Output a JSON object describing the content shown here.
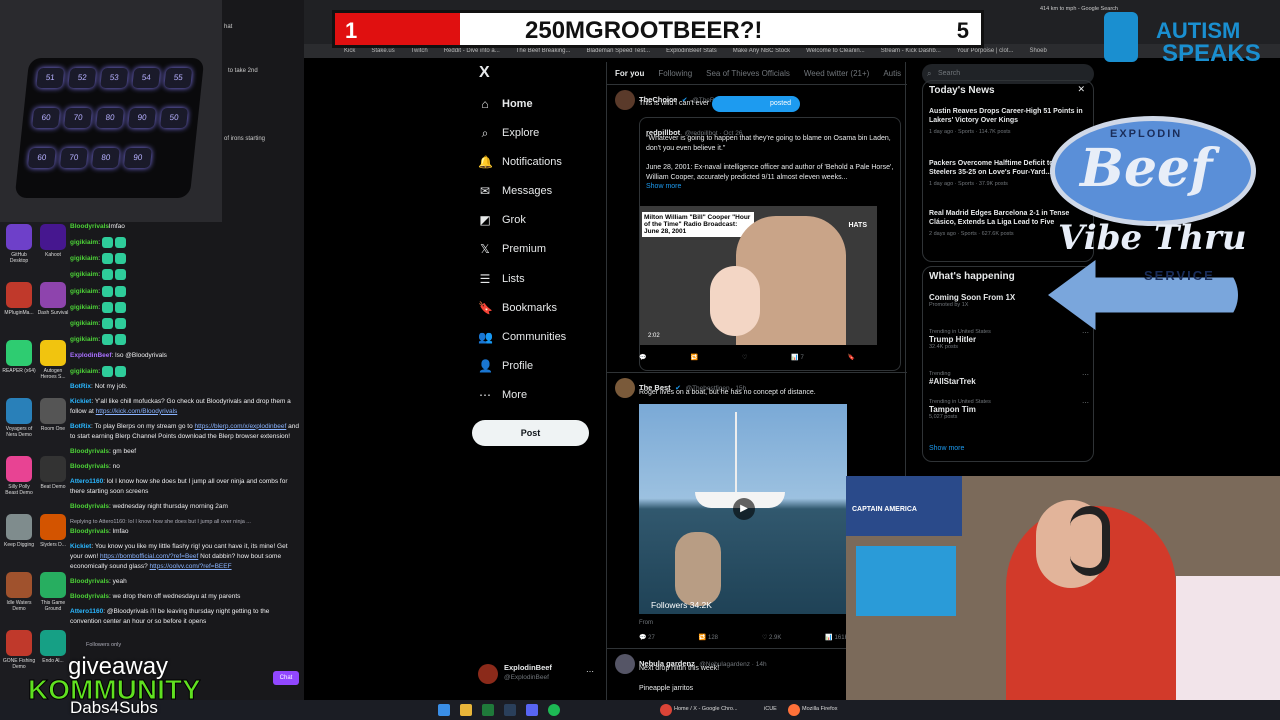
{
  "banner": {
    "left_score": "1",
    "title": "250MGROOTBEER?!",
    "right_score": "5"
  },
  "browser": {
    "bookmarks": [
      "Kick",
      "Stake.us",
      "Twitch",
      "Reddit - Dive into a...",
      "The Beef Breaking...",
      "Blademan Speed Test...",
      "ExplodinBeef Stats",
      "Make Any NBC Stock",
      "Welcome to Cleanin...",
      "Stream - Kick Dashb...",
      "Your Porpoise | clot...",
      "Shoeb"
    ],
    "tab_speed": "414 km to mph - Google Search"
  },
  "chat_panel": {
    "top_snippets": [
      "hat",
      "to take 2nd",
      "of irons starting"
    ],
    "messages": [
      {
        "user": "Bloodyrivals",
        "text": "lmfao",
        "type": "green"
      },
      {
        "user": "gigikiaim",
        "text": "",
        "emotes": 2,
        "type": "green"
      },
      {
        "user": "gigikiaim",
        "text": "",
        "emotes": 2,
        "type": "green"
      },
      {
        "user": "gigikiaim",
        "text": "",
        "emotes": 2,
        "type": "green"
      },
      {
        "user": "gigikiaim",
        "text": "",
        "emotes": 2,
        "type": "green"
      },
      {
        "user": "gigikiaim",
        "text": "",
        "emotes": 2,
        "type": "green"
      },
      {
        "user": "gigikiaim",
        "text": "",
        "emotes": 2,
        "type": "green"
      },
      {
        "user": "gigikiaim",
        "text": "",
        "emotes": 2,
        "type": "green"
      },
      {
        "user": "ExplodinBeef",
        "text": ": lso @Bloodyrivals",
        "type": "pur"
      },
      {
        "user": "gigikiaim",
        "text": "",
        "emotes": 2,
        "type": "green"
      },
      {
        "user": "BotRix",
        "text": ": Not my job.",
        "type": "bot"
      },
      {
        "user": "Kickiet",
        "text": ": Y'all like chill mofuckas? Go check out Bloodyrivals and drop them a follow at ",
        "link": "https://kick.com/Bloodyrivals",
        "type": "bot"
      },
      {
        "user": "BotRix",
        "text": ": To play Blerps on my stream go to ",
        "link": "https://blerp.com/x/explodinbeef",
        "text2": " and to start earning Blerp Channel Points download the Blerp browser extension!",
        "type": "bot"
      },
      {
        "user": "Bloodyrivals",
        "text": ": gm beef",
        "type": "green"
      },
      {
        "user": "Bloodyrivals",
        "text": ": no",
        "type": "green"
      },
      {
        "user": "Attero1160",
        "text": ": lol I know how she does but I jump all over ninja and combs for there starting soon screens",
        "type": "bot"
      },
      {
        "user": "Bloodyrivals",
        "text": ": wednesday night thursday morning 2am",
        "type": "green"
      },
      {
        "user": "Bloodyrivals",
        "text": ": lmfao",
        "reply": "Replying to Attero1160: lol I know how she does but I jump all over ninja ...",
        "type": "green"
      },
      {
        "user": "Kickiet",
        "text": ": You know you like my little flashy rig! you cant have it, its mine! Get your own! ",
        "link": "https://bombofficial.com/?ref=Beef",
        "text2": " Not dabbin? how bout some economically sound glass? ",
        "link2": "https://oolvv.com/?ref=BEEF",
        "type": "bot"
      },
      {
        "user": "Bloodyrivals",
        "text": ": yeah",
        "type": "green"
      },
      {
        "user": "Bloodyrivals",
        "text": ": we drop them off wednesdayu at my parents",
        "type": "green"
      },
      {
        "user": "Attero1160",
        "text": ": @Bloodyrivals i'll be leaving thursday night getting to the convention center an hour or so before it opens",
        "type": "bot"
      }
    ],
    "followers_only": "Followers only",
    "chat_button": "Chat"
  },
  "desktop_icons": [
    {
      "label": "GitHub Desktop",
      "color": "#6e40c9"
    },
    {
      "label": "Kahoot",
      "color": "#46178f"
    },
    {
      "label": "MPluginMa...",
      "color": "#c0392b"
    },
    {
      "label": "Dash Survival",
      "color": "#8e44ad"
    },
    {
      "label": "REAPER (x64)",
      "color": "#2ecc71"
    },
    {
      "label": "Autogen Heroes S...",
      "color": "#f1c40f"
    },
    {
      "label": "Voyagers of Nera Demo",
      "color": "#2980b9"
    },
    {
      "label": "Room One",
      "color": "#555555"
    },
    {
      "label": "Silly Polly Beast Demo",
      "color": "#e84393"
    },
    {
      "label": "Beat Demo",
      "color": "#333333"
    },
    {
      "label": "Keep Digging",
      "color": "#7f8c8d"
    },
    {
      "label": "Slyders D...",
      "color": "#d35400"
    },
    {
      "label": "Idle Waters Demo",
      "color": "#a0522d"
    },
    {
      "label": "This Game Ground",
      "color": "#27ae60"
    },
    {
      "label": "GONE Fishing Demo",
      "color": "#c0392b"
    },
    {
      "label": "Endo Al...",
      "color": "#16a085"
    }
  ],
  "keypad": [
    "51",
    "52",
    "53",
    "54",
    "55",
    "60",
    "70",
    "80",
    "90",
    "50",
    "60",
    "70",
    "80",
    "90"
  ],
  "sidebar": {
    "logo": "X",
    "items": [
      {
        "label": "Home",
        "icon": "home-icon",
        "glyph": "⌂"
      },
      {
        "label": "Explore",
        "icon": "search-icon",
        "glyph": "⌕"
      },
      {
        "label": "Notifications",
        "icon": "bell-icon",
        "glyph": "🔔"
      },
      {
        "label": "Messages",
        "icon": "mail-icon",
        "glyph": "✉"
      },
      {
        "label": "Grok",
        "icon": "grok-icon",
        "glyph": "◩"
      },
      {
        "label": "Premium",
        "icon": "x-premium-icon",
        "glyph": "𝕏"
      },
      {
        "label": "Lists",
        "icon": "list-icon",
        "glyph": "☰"
      },
      {
        "label": "Bookmarks",
        "icon": "bookmark-icon",
        "glyph": "🔖"
      },
      {
        "label": "Communities",
        "icon": "people-icon",
        "glyph": "👥"
      },
      {
        "label": "Profile",
        "icon": "user-icon",
        "glyph": "👤"
      },
      {
        "label": "More",
        "icon": "more-icon",
        "glyph": "⋯"
      }
    ],
    "post_button": "Post",
    "account_name": "ExplodinBeef",
    "account_handle": "@ExplodinBeef"
  },
  "feed": {
    "tabs": [
      "For you",
      "Following",
      "Sea of Thieves Officials",
      "Weed twitter (21+)",
      "Autis"
    ],
    "posted_pill": "posted",
    "tweet1": {
      "name": "TheChoice",
      "handle": "@TheRealChoice · 5h",
      "text": "This is wild I can't ever",
      "quote_name": "redpillbot",
      "quote_handle": "@redpillbot · Oct 26",
      "quote_text1": "\"Whatever is going to happen that they're going to blame on Osama bin Laden, don't you even believe it.\"",
      "quote_text2": "June 28, 2001: Ex-naval intelligence officer and author of 'Behold a Pale Horse', William Cooper, accurately predicted 9/11 almost eleven weeks...",
      "show_more": "Show more",
      "caption": "Milton William \"Bill\" Cooper \"Hour of the Time\" Radio Broadcast: June 28, 2001",
      "watermark": "HATS",
      "video_time": "2:02",
      "stats": [
        "",
        "",
        "",
        "7",
        ""
      ]
    },
    "tweet2": {
      "name": "The Best",
      "handle": "@Thebestfigen · 15h",
      "text": "Roger lives on a boat, but he has no concept of distance.",
      "overlay": "Followers 34.2K",
      "from": "From",
      "stats": [
        "27",
        "128",
        "2.9K",
        "161K"
      ]
    },
    "tweet3": {
      "name": "Nebula gardenz",
      "handle": "@Nebulagardenz · 14h",
      "text": "Next drop hittin this week!",
      "text2": "Pineapple jarritos"
    }
  },
  "right": {
    "search_placeholder": "Search",
    "news_title": "Today's News",
    "news": [
      {
        "title": "Austin Reaves Drops Career-High 51 Points in Lakers' Victory Over Kings",
        "meta": "1 day ago · Sports · 114.7K posts"
      },
      {
        "title": "Packers Overcome Halftime Deficit to Beat Steelers 35-25 on Love's Four-Yard...",
        "meta": "1 day ago · Sports · 37.9K posts"
      },
      {
        "title": "Real Madrid Edges Barcelona 2-1 in Tense Clásico, Extends La Liga Lead to Five",
        "meta": "2 days ago · Sports · 627.6K posts"
      }
    ],
    "happening_title": "What's happening",
    "trends": [
      {
        "cat": "",
        "name": "Coming Soon From 1X",
        "posts": "Promoted by 1X"
      },
      {
        "cat": "Trending in United States",
        "name": "Trump Hitler",
        "posts": "32.4K posts"
      },
      {
        "cat": "Trending",
        "name": "#AllStarTrek",
        "posts": ""
      },
      {
        "cat": "Trending in United States",
        "name": "Tampon Tim",
        "posts": "5,027 posts"
      }
    ],
    "show_more": "Show more"
  },
  "overlay": {
    "autism_line1": "AUTISM",
    "autism_line2": "SPEAKS",
    "beef_top": "EXPLODIN",
    "beef_main": "Beef",
    "beef_sub": "Vibe Thru",
    "beef_service": "SERVICE",
    "giveaway": "giveaway",
    "kommunity": "KOMMUNITY",
    "dabs": "Dabs4Subs",
    "cam_text": "CAPTAIN AMERICA"
  },
  "taskbar": {
    "items": [
      "Home / X - Google Chro...",
      "iCUE",
      "Mozilla Firefox"
    ]
  },
  "colors": {
    "x_bg": "#000000",
    "banner_red": "#e01010",
    "kick_green": "#53fc18",
    "twitch_purple": "#9147ff",
    "link": "#1d9bf0"
  }
}
